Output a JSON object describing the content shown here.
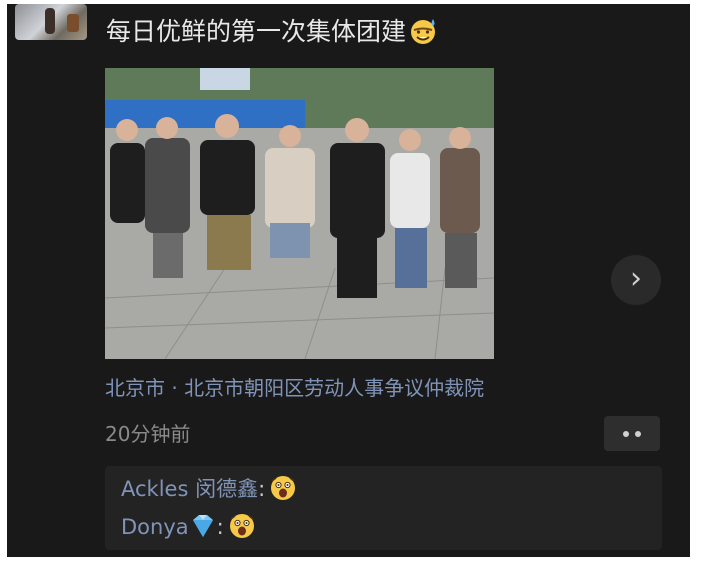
{
  "post": {
    "author_avatar": "avatar-photo",
    "text": "每日优鲜的第一次集体团建",
    "text_emoji": "sweat-smile-emoji",
    "photo": "crowd-photo",
    "location": "北京市 · 北京市朝阳区劳动人事争议仲裁院",
    "time": "20分钟前",
    "more_icon": "more-dots-icon",
    "next_icon": "chevron-right-icon"
  },
  "comments": [
    {
      "name": "Ackles 闵德鑫",
      "separator": ":",
      "emoji": "shocked-face-emoji"
    },
    {
      "name": "Donya",
      "name_emoji": "gem-emoji",
      "separator": ":",
      "emoji": "shocked-face-emoji"
    }
  ],
  "colors": {
    "background": "#191919",
    "link": "#8094b8",
    "text": "#e8e8e8",
    "muted": "#8a8a8a"
  }
}
